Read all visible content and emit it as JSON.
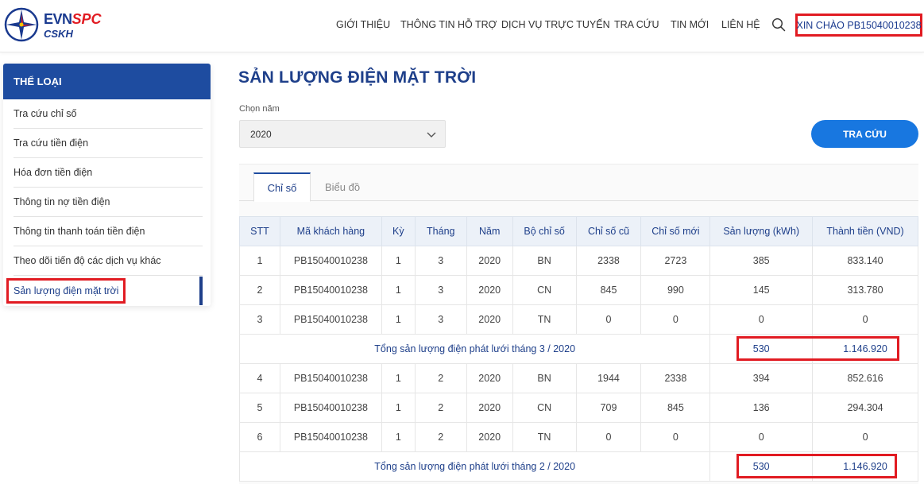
{
  "header": {
    "logo": {
      "brand": "EVN",
      "brand_accent": "SPC",
      "subtitle": "CSKH"
    },
    "nav": [
      "GIỚI THIỆU",
      "THÔNG TIN HỖ TRỢ",
      "DỊCH VỤ TRỰC TUYẾN",
      "TRA CỨU",
      "TIN MỚI",
      "LIÊN HỆ"
    ],
    "greeting": "XIN CHÀO PB15040010238",
    "search_icon": "search-icon"
  },
  "sidebar": {
    "title": "THỂ LOẠI",
    "items": [
      "Tra cứu chỉ số",
      "Tra cứu tiền điện",
      "Hóa đơn tiền điện",
      "Thông tin nợ tiền điện",
      "Thông tin thanh toán tiền điện",
      "Theo dõi tiến độ các dịch vụ khác",
      "Sản lượng điện mặt trời"
    ],
    "active_index": 6
  },
  "main": {
    "title": "SẢN LƯỢNG ĐIỆN MẶT TRỜI",
    "year_label": "Chọn năm",
    "year_value": "2020",
    "search_button": "TRA CỨU",
    "tabs": [
      "Chỉ số",
      "Biểu đồ"
    ],
    "active_tab": 0
  },
  "table": {
    "headers": [
      "STT",
      "Mã khách hàng",
      "Kỳ",
      "Tháng",
      "Năm",
      "Bộ chỉ số",
      "Chỉ số cũ",
      "Chỉ số mới",
      "Sản lượng (kWh)",
      "Thành tiền (VND)"
    ],
    "groups": [
      {
        "rows": [
          [
            "1",
            "PB15040010238",
            "1",
            "3",
            "2020",
            "BN",
            "2338",
            "2723",
            "385",
            "833.140"
          ],
          [
            "2",
            "PB15040010238",
            "1",
            "3",
            "2020",
            "CN",
            "845",
            "990",
            "145",
            "313.780"
          ],
          [
            "3",
            "PB15040010238",
            "1",
            "3",
            "2020",
            "TN",
            "0",
            "0",
            "0",
            "0"
          ]
        ],
        "total_label": "Tổng sản lượng điện phát lưới tháng 3 / 2020",
        "total_kwh": "530",
        "total_vnd": "1.146.920"
      },
      {
        "rows": [
          [
            "4",
            "PB15040010238",
            "1",
            "2",
            "2020",
            "BN",
            "1944",
            "2338",
            "394",
            "852.616"
          ],
          [
            "5",
            "PB15040010238",
            "1",
            "2",
            "2020",
            "CN",
            "709",
            "845",
            "136",
            "294.304"
          ],
          [
            "6",
            "PB15040010238",
            "1",
            "2",
            "2020",
            "TN",
            "0",
            "0",
            "0",
            "0"
          ]
        ],
        "total_label": "Tổng sản lượng điện phát lưới tháng 2 / 2020",
        "total_kwh": "530",
        "total_vnd": "1.146.920"
      }
    ]
  },
  "colors": {
    "brand_blue": "#1e3f8a",
    "sidebar_head": "#1e4ca0",
    "button_blue": "#1877e0",
    "highlight_red": "#e11b22"
  }
}
